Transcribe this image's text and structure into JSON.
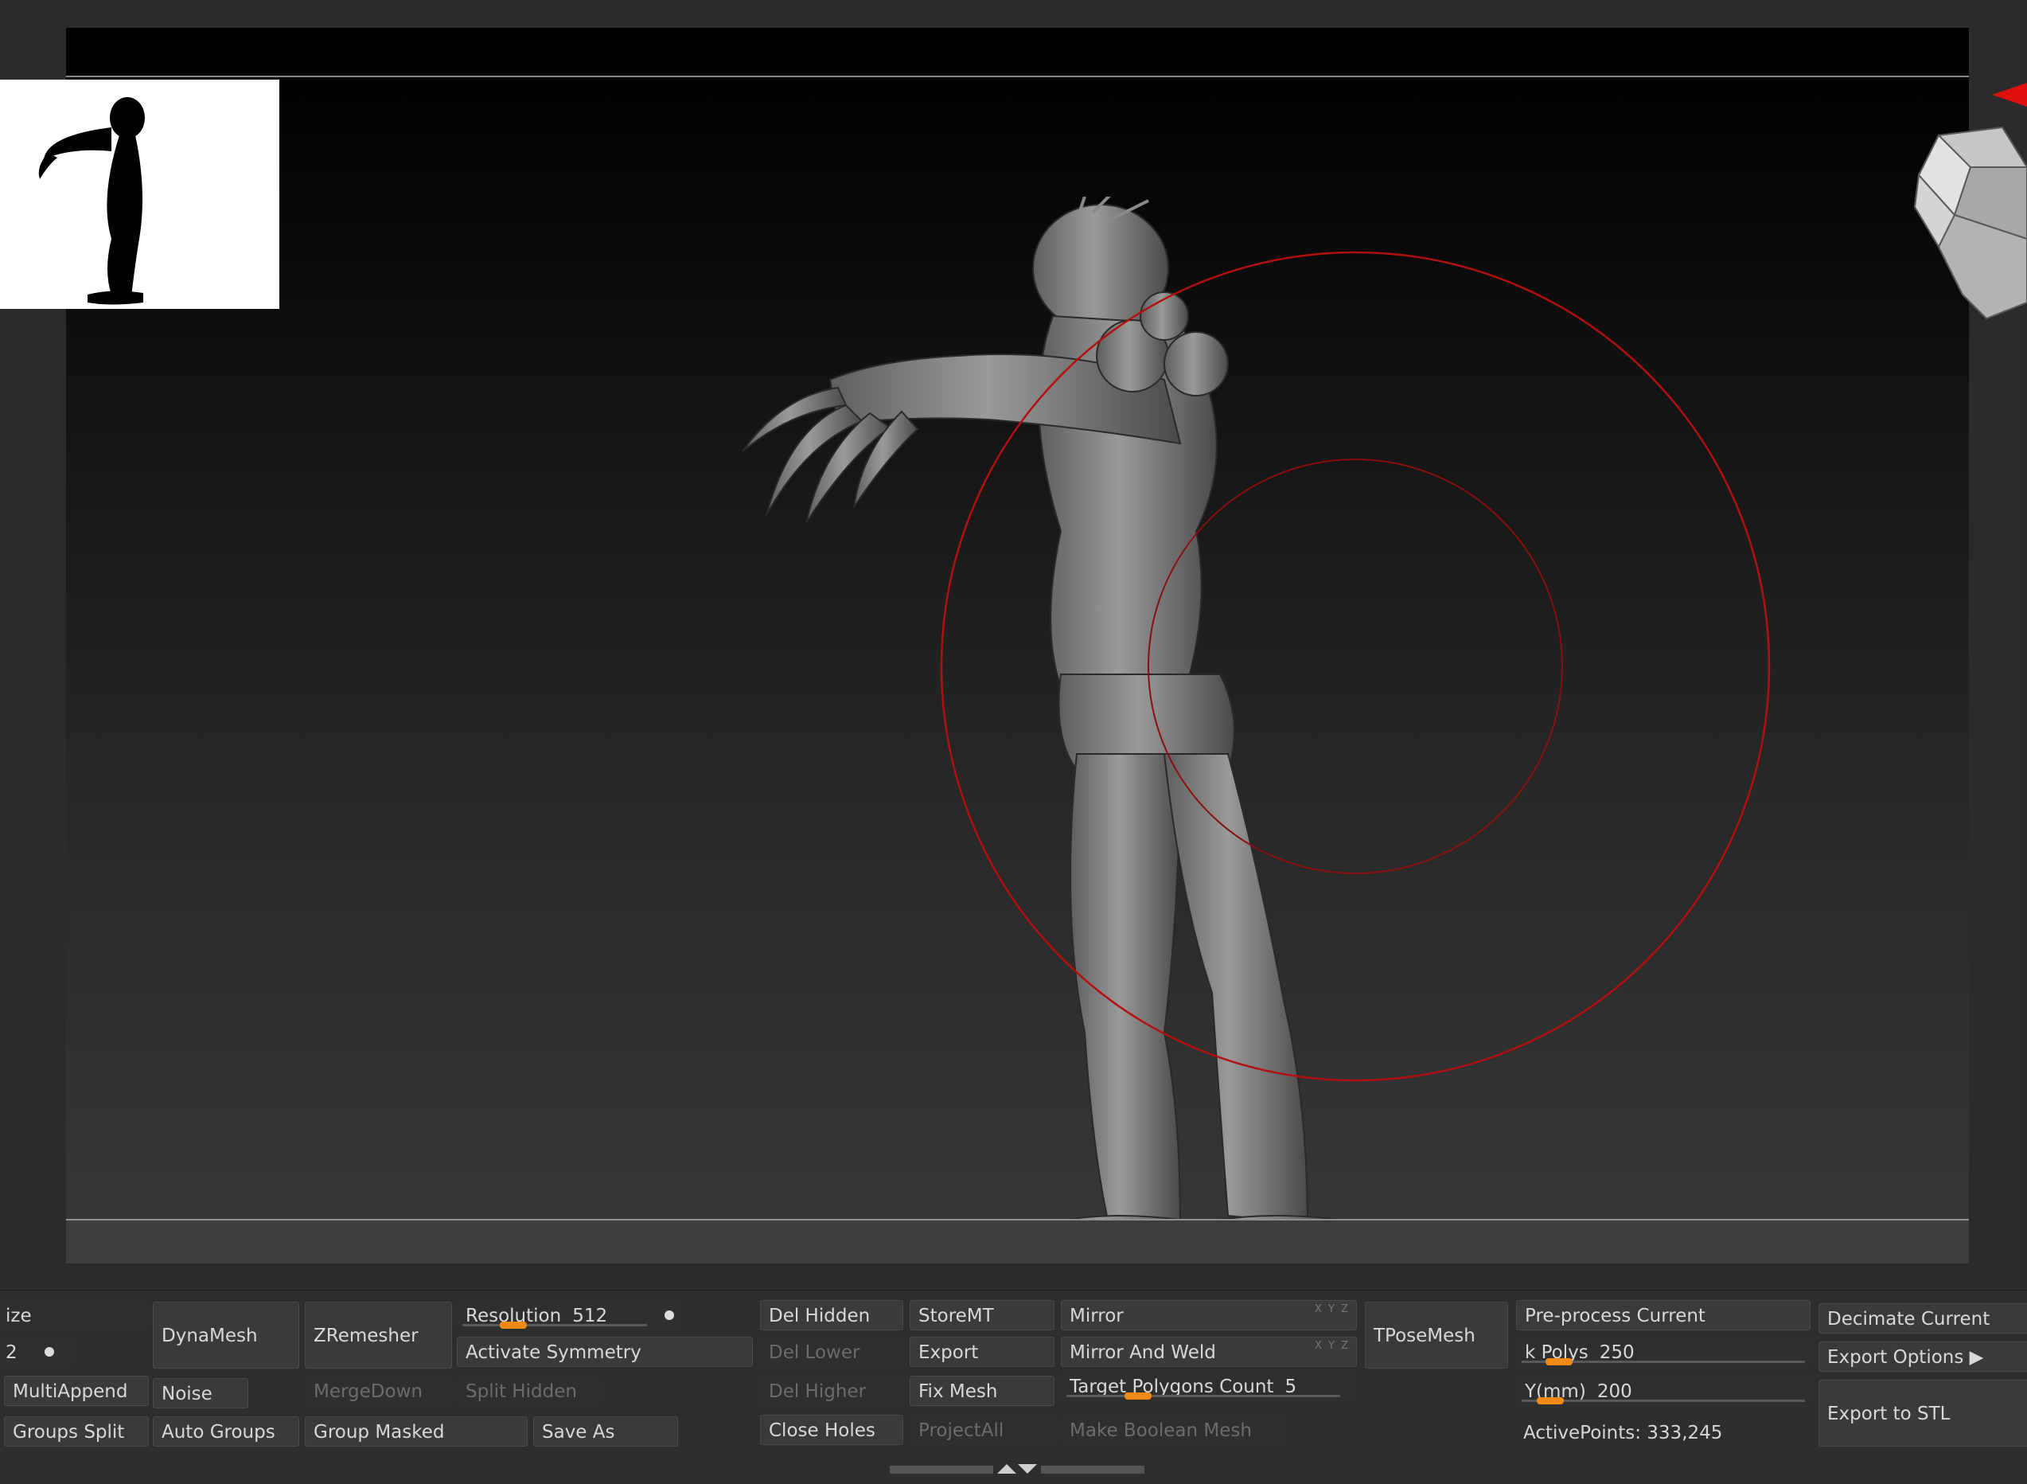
{
  "viewport": {
    "background": "gradient black to grey",
    "brush_cursor_color": "#b21010",
    "thumbnail": "silhouette",
    "navigation_gizmo": "head-icon"
  },
  "palette": {
    "col1": {
      "top": "ize",
      "value": "2",
      "multiappend": "MultiAppend",
      "groups_split": "Groups Split"
    },
    "col2": {
      "dynamesh": "DynaMesh",
      "noise": "Noise",
      "auto_groups": "Auto Groups"
    },
    "col3": {
      "zremesher": "ZRemesher",
      "mergedown": "MergeDown",
      "group_masked": "Group Masked"
    },
    "col4": {
      "resolution_label": "Resolution",
      "resolution_value": "512",
      "resolution_level": 0.23,
      "activate_symmetry": "Activate Symmetry",
      "split_hidden": "Split Hidden",
      "save_as": "Save As"
    },
    "col5": {
      "del_hidden": "Del Hidden",
      "del_lower": "Del Lower",
      "del_higher": "Del Higher",
      "close_holes": "Close Holes"
    },
    "col6": {
      "storemt": "StoreMT",
      "export": "Export",
      "fix_mesh": "Fix Mesh",
      "projectall": "ProjectAll"
    },
    "col7": {
      "mirror": "Mirror",
      "mirror_and_weld": "Mirror And Weld",
      "xyz": "X Y Z",
      "target_label": "Target Polygons Count",
      "target_value": "5",
      "target_level": 0.23,
      "make_boolean_mesh": "Make Boolean Mesh"
    },
    "col8": {
      "tposemesh": "TPoseMesh"
    },
    "col9": {
      "preprocess": "Pre-process Current",
      "kpolys_label": "k Polys",
      "kpolys_value": "250",
      "kpolys_level": 0.1,
      "ymm_label": "Y(mm)",
      "ymm_value": "200",
      "ymm_level": 0.07,
      "active_points": "ActivePoints: 333,245"
    },
    "col10": {
      "decimate_current": "Decimate Current",
      "export_options": "Export Options ▶",
      "export_to_stl": "Export to STL"
    }
  },
  "accent_color": "#f08a12"
}
